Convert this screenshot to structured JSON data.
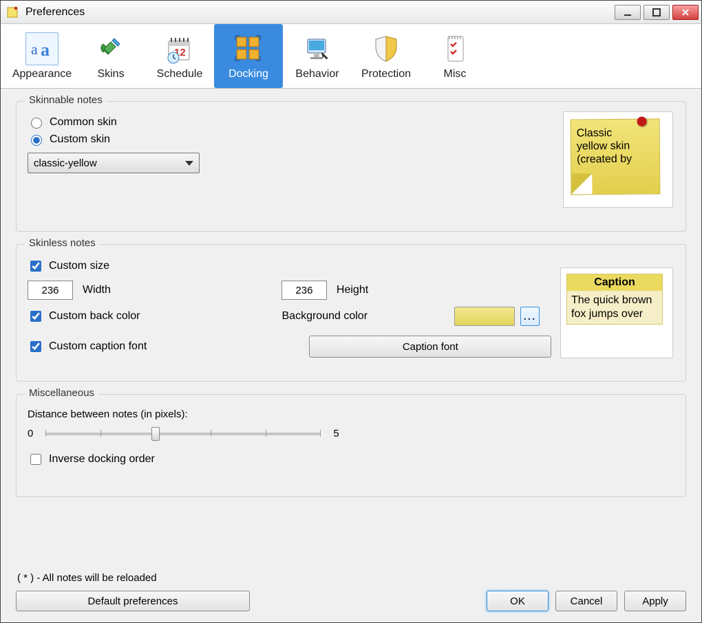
{
  "window": {
    "title": "Preferences"
  },
  "tabs": [
    {
      "id": "appearance",
      "label": "Appearance"
    },
    {
      "id": "skins",
      "label": "Skins"
    },
    {
      "id": "schedule",
      "label": "Schedule"
    },
    {
      "id": "docking",
      "label": "Docking",
      "active": true
    },
    {
      "id": "behavior",
      "label": "Behavior"
    },
    {
      "id": "protection",
      "label": "Protection"
    },
    {
      "id": "misc",
      "label": "Misc"
    }
  ],
  "skinnable": {
    "title": "Skinnable notes",
    "radio_common": "Common skin",
    "radio_custom": "Custom skin",
    "selected_radio": "custom",
    "combo_value": "classic-yellow",
    "preview_line1": "Classic",
    "preview_line2": "yellow skin",
    "preview_line3": "(created by"
  },
  "skinless": {
    "title": "Skinless notes",
    "chk_size": "Custom size",
    "chk_back": "Custom back color",
    "chk_caption": "Custom caption font",
    "width_label": "Width",
    "height_label": "Height",
    "width_value": "236",
    "height_value": "236",
    "bgcolor_label": "Background color",
    "bgcolor_hex": "#e6d659",
    "caption_btn": "Caption font",
    "preview_caption": "Caption",
    "preview_text": "The quick brown fox jumps over"
  },
  "misc": {
    "title": "Miscellaneous",
    "distance_label": "Distance between notes (in pixels):",
    "slider_min": "0",
    "slider_max": "5",
    "slider_value": 2,
    "chk_inverse": "Inverse docking order"
  },
  "footer": {
    "note": "( * ) - All notes will be reloaded",
    "default": "Default preferences",
    "ok": "OK",
    "cancel": "Cancel",
    "apply": "Apply"
  }
}
